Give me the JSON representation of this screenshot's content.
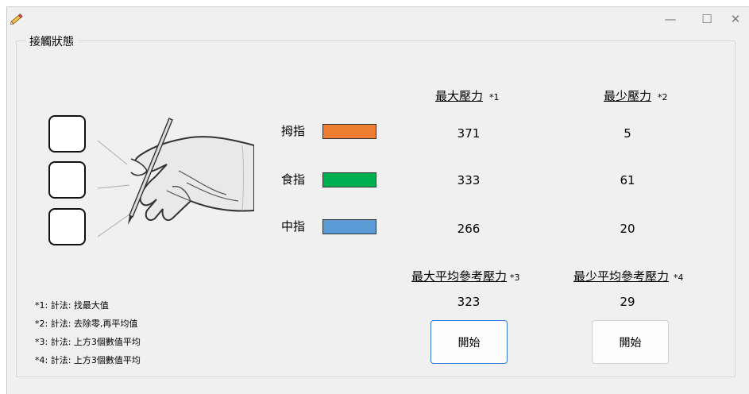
{
  "window": {
    "minimize": "—",
    "maximize": "☐",
    "close": "✕"
  },
  "group_title": "接觸狀態",
  "headers": {
    "max_pressure": "最大壓力",
    "max_pressure_mark": "*1",
    "min_pressure": "最少壓力",
    "min_pressure_mark": "*2",
    "max_avg_ref": "最大平均參考壓力",
    "max_avg_ref_mark": "*3",
    "min_avg_ref": "最少平均參考壓力",
    "min_avg_ref_mark": "*4"
  },
  "fingers": [
    {
      "label": "拇指",
      "color": "#ed7d31",
      "max": "371",
      "min": "5"
    },
    {
      "label": "食指",
      "color": "#00b050",
      "max": "333",
      "min": "61"
    },
    {
      "label": "中指",
      "color": "#5b9bd5",
      "max": "266",
      "min": "20"
    }
  ],
  "averages": {
    "max_avg": "323",
    "min_avg": "29"
  },
  "buttons": {
    "start_left": "開始",
    "start_right": "開始"
  },
  "notes": [
    "*1: 計法: 找最大值",
    "*2: 計法: 去除零,再平均值",
    "*3: 計法: 上方3個數值平均",
    "*4: 計法: 上方3個數值平均"
  ],
  "icons": {
    "app": "pencil-icon",
    "illustration": "hand-holding-pen-icon"
  }
}
